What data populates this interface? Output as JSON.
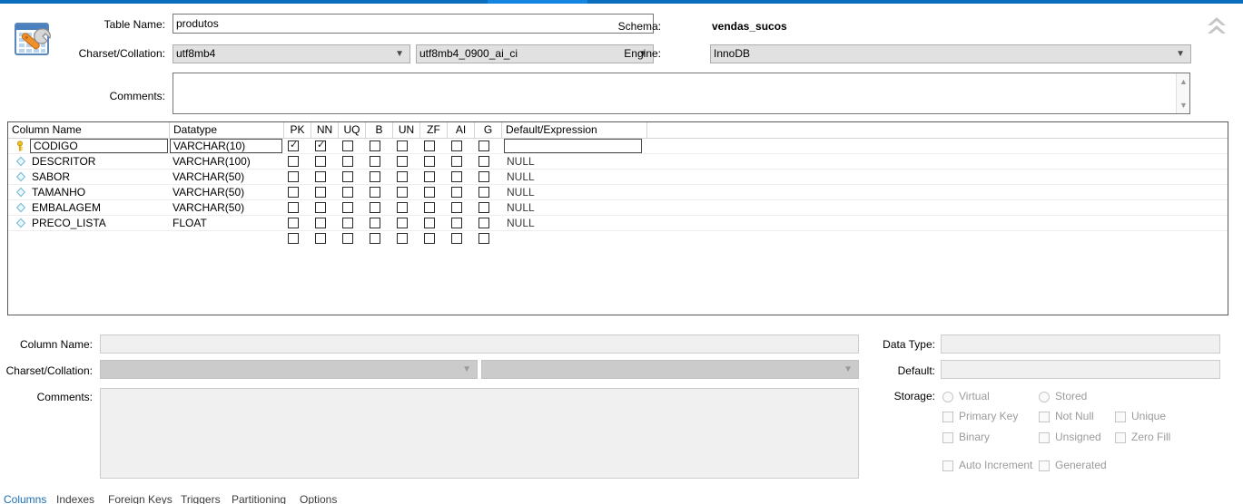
{
  "window": {
    "accent_color": "#0a6ebd",
    "accent_active_color": "#1384e0",
    "collapse_icon": "chevron-double-up-icon",
    "editor_icon": "table-wrench-icon"
  },
  "header": {
    "table_name_label": "Table Name:",
    "table_name_value": "produtos",
    "schema_label": "Schema:",
    "schema_value": "vendas_sucos",
    "charset_label": "Charset/Collation:",
    "charset_value": "utf8mb4",
    "collation_value": "utf8mb4_0900_ai_ci",
    "engine_label": "Engine:",
    "engine_value": "InnoDB",
    "comments_label": "Comments:",
    "comments_value": "",
    "scroll_up_icon": "chevron-up-icon",
    "scroll_down_icon": "chevron-down-icon"
  },
  "grid": {
    "headers": [
      "Column Name",
      "Datatype",
      "PK",
      "NN",
      "UQ",
      "B",
      "UN",
      "ZF",
      "AI",
      "G",
      "Default/Expression"
    ],
    "rows": [
      {
        "icon": "primary-key-icon",
        "name": "CODIGO",
        "datatype": "VARCHAR(10)",
        "flags": [
          true,
          true,
          false,
          false,
          false,
          false,
          false,
          false
        ],
        "default": "",
        "editing": true
      },
      {
        "icon": "column-diamond-icon",
        "name": "DESCRITOR",
        "datatype": "VARCHAR(100)",
        "flags": [
          false,
          false,
          false,
          false,
          false,
          false,
          false,
          false
        ],
        "default": "NULL",
        "editing": false
      },
      {
        "icon": "column-diamond-icon",
        "name": "SABOR",
        "datatype": "VARCHAR(50)",
        "flags": [
          false,
          false,
          false,
          false,
          false,
          false,
          false,
          false
        ],
        "default": "NULL",
        "editing": false
      },
      {
        "icon": "column-diamond-icon",
        "name": "TAMANHO",
        "datatype": "VARCHAR(50)",
        "flags": [
          false,
          false,
          false,
          false,
          false,
          false,
          false,
          false
        ],
        "default": "NULL",
        "editing": false
      },
      {
        "icon": "column-diamond-icon",
        "name": "EMBALAGEM",
        "datatype": "VARCHAR(50)",
        "flags": [
          false,
          false,
          false,
          false,
          false,
          false,
          false,
          false
        ],
        "default": "NULL",
        "editing": false
      },
      {
        "icon": "column-diamond-icon",
        "name": "PRECO_LISTA",
        "datatype": "FLOAT",
        "flags": [
          false,
          false,
          false,
          false,
          false,
          false,
          false,
          false
        ],
        "default": "NULL",
        "editing": false
      },
      {
        "icon": "",
        "name": "",
        "datatype": "",
        "flags": [
          false,
          false,
          false,
          false,
          false,
          false,
          false,
          false
        ],
        "default": "",
        "editing": false
      }
    ]
  },
  "detail": {
    "column_name_label": "Column Name:",
    "column_name_value": "",
    "charset_label": "Charset/Collation:",
    "charset_value": "",
    "collation_value": "",
    "comments_label": "Comments:",
    "comments_value": "",
    "data_type_label": "Data Type:",
    "data_type_value": "",
    "default_label": "Default:",
    "default_value": "",
    "storage_label": "Storage:",
    "storage_options": [
      {
        "label": "Virtual",
        "kind": "radio",
        "checked": false
      },
      {
        "label": "Stored",
        "kind": "radio",
        "checked": false
      }
    ],
    "flag_options": [
      {
        "label": "Primary Key",
        "kind": "check",
        "checked": false
      },
      {
        "label": "Not Null",
        "kind": "check",
        "checked": false
      },
      {
        "label": "Unique",
        "kind": "check",
        "checked": false
      },
      {
        "label": "Binary",
        "kind": "check",
        "checked": false
      },
      {
        "label": "Unsigned",
        "kind": "check",
        "checked": false
      },
      {
        "label": "Zero Fill",
        "kind": "check",
        "checked": false
      },
      {
        "label": "Auto Increment",
        "kind": "check",
        "checked": false
      },
      {
        "label": "Generated",
        "kind": "check",
        "checked": false
      }
    ]
  },
  "tabs": {
    "active": "Columns",
    "active_color": "#1a6fb5",
    "items": [
      "Columns",
      "Indexes",
      "Foreign Keys",
      "Triggers",
      "Partitioning",
      "Options"
    ]
  }
}
